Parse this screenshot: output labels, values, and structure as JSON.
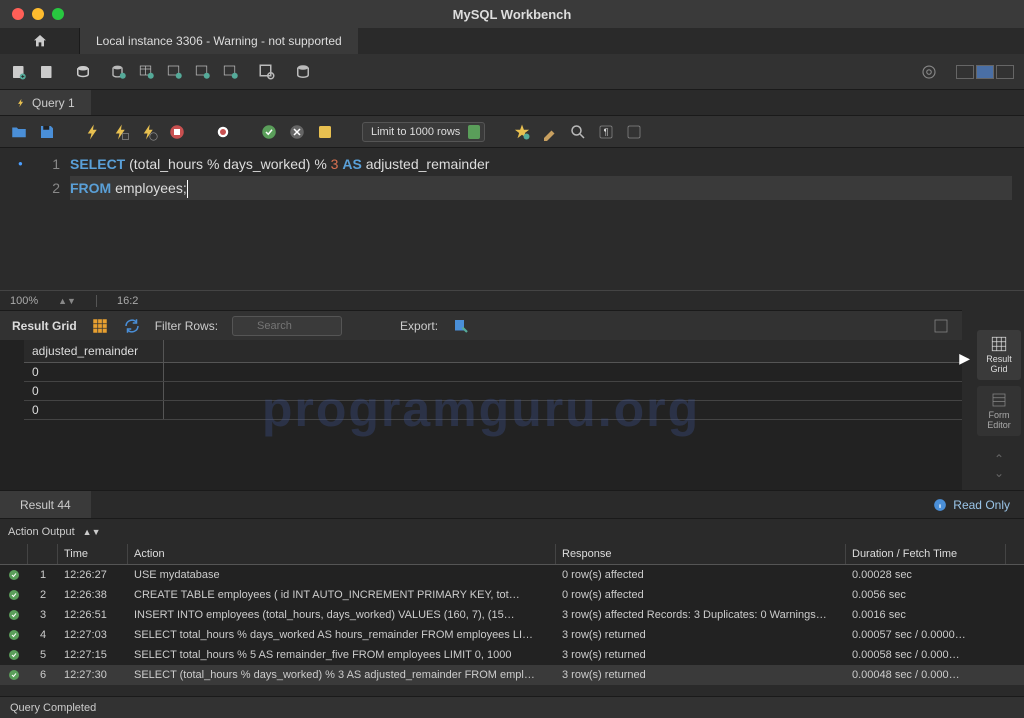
{
  "titlebar": {
    "title": "MySQL Workbench"
  },
  "connection_tab": "Local instance 3306 - Warning - not supported",
  "query_tab": {
    "label": "Query 1"
  },
  "limit_dropdown": "Limit to 1000 rows",
  "editor": {
    "lines": [
      {
        "n": "1",
        "html": "<span class='kw'>SELECT</span> <span class='txt'>(total_hours % days_worked) % </span><span class='num'>3</span> <span class='kw'>AS</span> <span class='txt'>adjusted_remainder</span>"
      },
      {
        "n": "2",
        "html": "<span class='kw'>FROM</span> <span class='txt'>employees;</span><span class='cursor'></span>"
      }
    ]
  },
  "editor_status": {
    "zoom": "100%",
    "pos": "16:2"
  },
  "result_header": {
    "label": "Result Grid",
    "filter_label": "Filter Rows:",
    "filter_placeholder": "Search",
    "export_label": "Export:"
  },
  "grid": {
    "column": "adjusted_remainder",
    "rows": [
      "0",
      "0",
      "0"
    ]
  },
  "watermark": "programguru.org",
  "right_panels": {
    "result_grid": "Result\nGrid",
    "form_editor": "Form\nEditor"
  },
  "result_tab": "Result 44",
  "readonly": "Read Only",
  "output_header": "Action Output",
  "output_columns": {
    "time": "Time",
    "action": "Action",
    "response": "Response",
    "duration": "Duration / Fetch Time"
  },
  "output_rows": [
    {
      "idx": "1",
      "time": "12:26:27",
      "action": "USE mydatabase",
      "response": "0 row(s) affected",
      "duration": "0.00028 sec"
    },
    {
      "idx": "2",
      "time": "12:26:38",
      "action": "CREATE TABLE employees (     id INT AUTO_INCREMENT PRIMARY KEY,     tot…",
      "response": "0 row(s) affected",
      "duration": "0.0056 sec"
    },
    {
      "idx": "3",
      "time": "12:26:51",
      "action": "INSERT INTO employees (total_hours, days_worked) VALUES (160, 7),     (15…",
      "response": "3 row(s) affected Records: 3  Duplicates: 0  Warnings…",
      "duration": "0.0016 sec"
    },
    {
      "idx": "4",
      "time": "12:27:03",
      "action": "SELECT total_hours % days_worked AS hours_remainder FROM employees LI…",
      "response": "3 row(s) returned",
      "duration": "0.00057 sec / 0.0000…"
    },
    {
      "idx": "5",
      "time": "12:27:15",
      "action": "SELECT total_hours % 5 AS remainder_five FROM employees LIMIT 0, 1000",
      "response": "3 row(s) returned",
      "duration": "0.00058 sec / 0.000…"
    },
    {
      "idx": "6",
      "time": "12:27:30",
      "action": "SELECT (total_hours % days_worked) % 3 AS adjusted_remainder FROM empl…",
      "response": "3 row(s) returned",
      "duration": "0.00048 sec / 0.000…"
    }
  ],
  "statusbar": "Query Completed"
}
